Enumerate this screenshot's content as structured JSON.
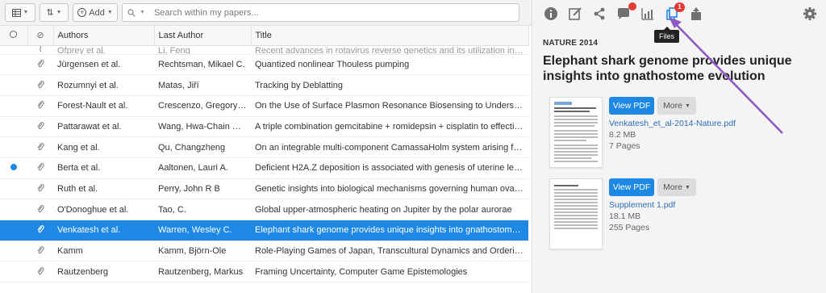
{
  "toolbar": {
    "add_label": "Add",
    "search_placeholder": "Search within my papers..."
  },
  "table": {
    "headers": {
      "authors": "Authors",
      "last_author": "Last Author",
      "title": "Title"
    },
    "partial_row": {
      "authors": "Ofprey et al.",
      "last_author": "Li, Feng",
      "title": "Recent advances in rotavirus reverse genetics and its utilization in basic ..."
    },
    "rows": [
      {
        "authors": "Jürgensen et al.",
        "last_author": "Rechtsman, Mikael C.",
        "title": "Quantized nonlinear Thouless pumping",
        "unread": false,
        "selected": false
      },
      {
        "authors": "Rozumnyi et al.",
        "last_author": "Matas, Jiří",
        "title": "Tracking by Deblatting",
        "unread": false,
        "selected": false
      },
      {
        "authors": "Forest-Nault et al.",
        "last_author": "Crescenzo, Gregory De",
        "title": "On the Use of Surface Plasmon Resonance Biosensing to Understand Ig...",
        "unread": false,
        "selected": false
      },
      {
        "authors": "Pattarawat et al.",
        "last_author": "Wang, Hwa-Chain Rob...",
        "title": "A triple combination gemcitabine + romidepsin + cisplatin to effectivel...",
        "unread": false,
        "selected": false
      },
      {
        "authors": "Kang et al.",
        "last_author": "Qu, Changzheng",
        "title": "On an integrable multi-component CamassaHolm system arising from ...",
        "unread": false,
        "selected": false
      },
      {
        "authors": "Berta et al.",
        "last_author": "Aaltonen, Lauri A.",
        "title": "Deficient H2A.Z deposition is associated with genesis of uterine leiomy...",
        "unread": true,
        "selected": false
      },
      {
        "authors": "Ruth et al.",
        "last_author": "Perry, John R B",
        "title": "Genetic insights into biological mechanisms governing human ovarian ...",
        "unread": false,
        "selected": false
      },
      {
        "authors": "O'Donoghue et al.",
        "last_author": "Tao, C.",
        "title": "Global upper-atmospheric heating on Jupiter by the polar aurorae",
        "unread": false,
        "selected": false
      },
      {
        "authors": "Venkatesh et al.",
        "last_author": "Warren, Wesley C.",
        "title": "Elephant shark genome provides unique insights into gnathostome evo...",
        "unread": false,
        "selected": true
      },
      {
        "authors": "Kamm",
        "last_author": "Kamm, Björn-Ole",
        "title": "Role-Playing Games of Japan, Transcultural Dynamics and Orderings",
        "unread": false,
        "selected": false
      },
      {
        "authors": "Rautzenberg",
        "last_author": "Rautzenberg, Markus",
        "title": "Framing Uncertainty, Computer Game Epistemologies",
        "unread": false,
        "selected": false
      }
    ]
  },
  "detail": {
    "tooltip": "Files",
    "files_badge": "1",
    "journal": "NATURE 2014",
    "title": "Elephant shark genome provides unique insights into gnathostome evolution",
    "files": [
      {
        "name": "Venkatesh_et_al-2014-Nature.pdf",
        "size": "8.2 MB",
        "pages": "7 Pages",
        "view_label": "View PDF",
        "more_label": "More"
      },
      {
        "name": "Supplement 1.pdf",
        "size": "18.1 MB",
        "pages": "255 Pages",
        "view_label": "View PDF",
        "more_label": "More"
      }
    ]
  },
  "colors": {
    "accent": "#1e88e5",
    "badge": "#e53935",
    "annotation_arrow": "#8e5bc6"
  }
}
